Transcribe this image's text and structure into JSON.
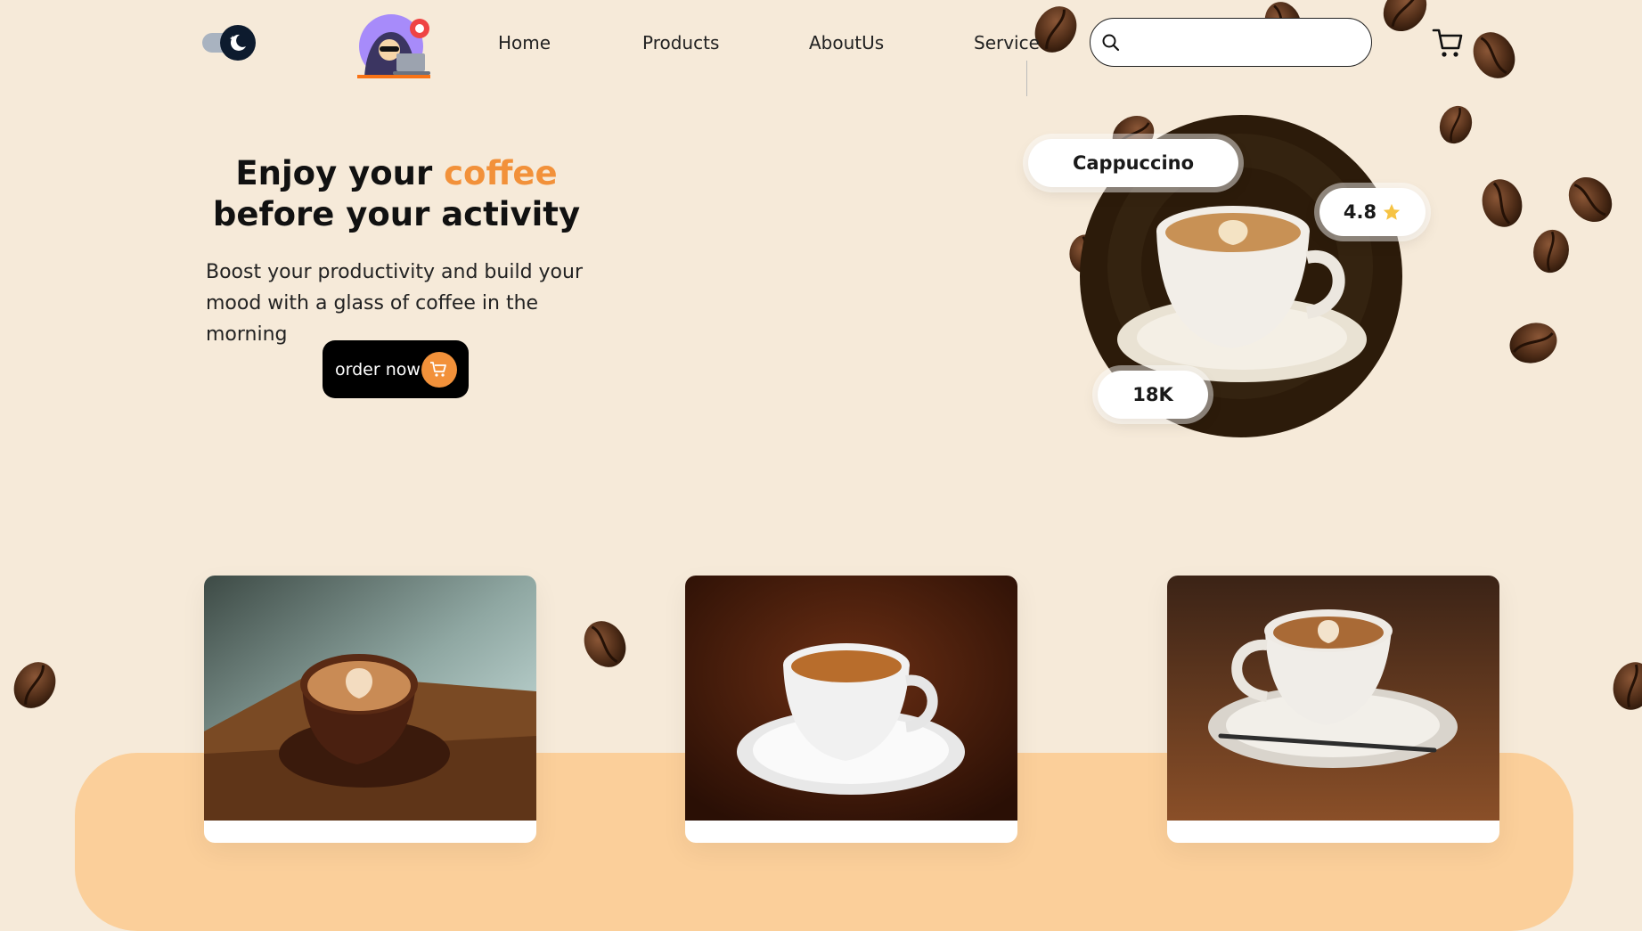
{
  "theme": {
    "background": "#f6ead9",
    "accent": "#f2913a",
    "dark": "#0d1b2e",
    "coffee_circle": "#2c1b0a",
    "band": "#fbcf9a"
  },
  "header": {
    "theme_toggle_icon": "moon-icon",
    "avatar_icon": "hacker-avatar-icon",
    "nav": [
      "Home",
      "Products",
      "AboutUs",
      "Service"
    ],
    "search": {
      "value": "",
      "placeholder": "",
      "icon": "search-icon"
    },
    "cart_icon": "cart-icon"
  },
  "hero": {
    "title_part1": "Enjoy your ",
    "title_accent": "coffee",
    "title_part2": "before your activity",
    "subtitle_line1": "Boost your productivity and build your",
    "subtitle_line2": "mood with a glass of coffee in the morning",
    "order_button": "order now",
    "product": {
      "name": "Cappuccino",
      "rating": "4.8",
      "rating_icon": "star-icon",
      "count": "18K"
    }
  },
  "cards": [
    {
      "image": "latte-art-cup-on-wooden-table"
    },
    {
      "image": "espresso-white-cup-on-saucer"
    },
    {
      "image": "latte-art-cup-with-spoon"
    }
  ]
}
